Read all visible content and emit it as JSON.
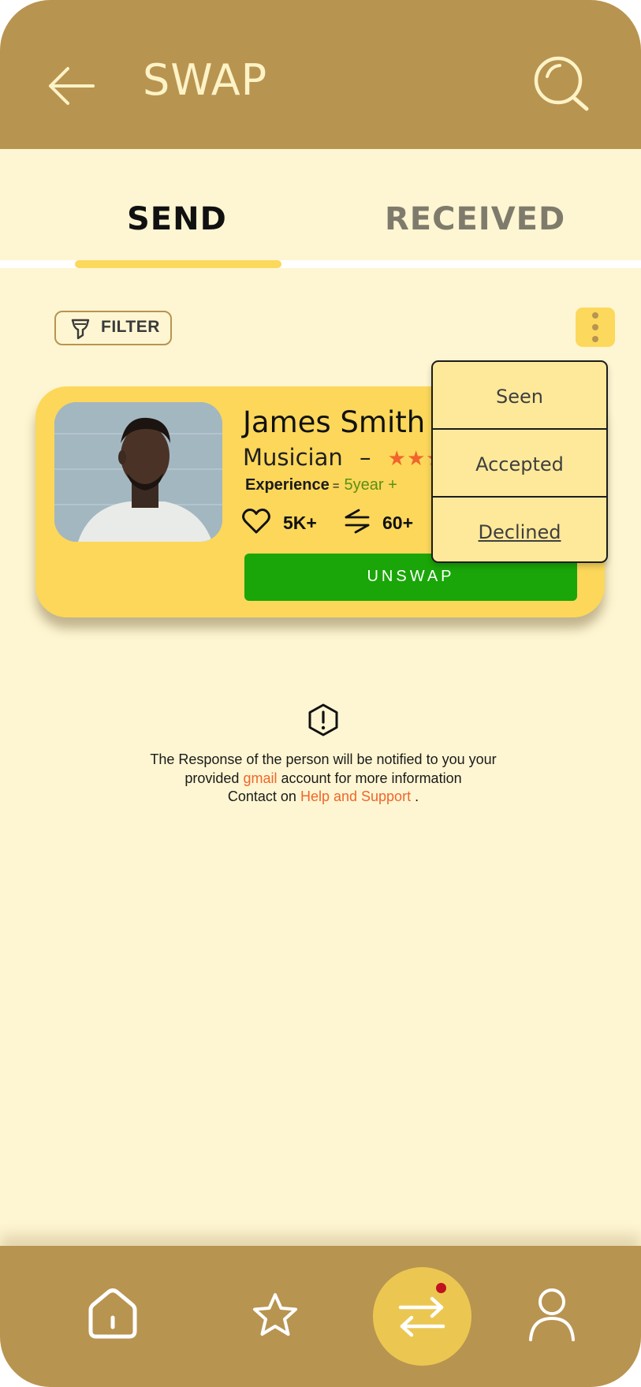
{
  "header": {
    "title": "SWAP",
    "back_icon": "arrow-left-icon",
    "search_icon": "search-icon"
  },
  "tabs": [
    {
      "label": "SEND",
      "active": true
    },
    {
      "label": "RECEIVED",
      "active": false
    }
  ],
  "filter": {
    "label": "FILTER",
    "icon": "filter-icon"
  },
  "menu": {
    "icon": "more-vertical-icon",
    "items": [
      {
        "label": "Seen"
      },
      {
        "label": "Accepted"
      },
      {
        "label": "Declined"
      }
    ]
  },
  "card": {
    "name": "James Smith",
    "role": "Musician",
    "role_separator": "–",
    "stars_display": "★★★★★",
    "experience_label": "Experience",
    "experience_sep": "=",
    "experience_value": "5year +",
    "likes": "5K+",
    "swaps": "60+",
    "button_label": "UNSWAP"
  },
  "info": {
    "line1": "The Response of the person will be notified to you your",
    "line2_prefix": "provided",
    "line2_link": "gmail",
    "line2_suffix": "account for more information",
    "line3_prefix": "Contact on",
    "line3_link": "Help and Support",
    "line3_suffix": "."
  },
  "bottom_nav": {
    "items": [
      {
        "icon": "home-icon"
      },
      {
        "icon": "star-icon"
      },
      {
        "icon": "swap-icon",
        "active": true,
        "notification": true
      },
      {
        "icon": "profile-icon"
      }
    ]
  },
  "colors": {
    "header": "#b89451",
    "background": "#fef6d2",
    "card": "#fcd75a",
    "accent_orange": "#f0652d",
    "button_green": "#1aa608"
  }
}
